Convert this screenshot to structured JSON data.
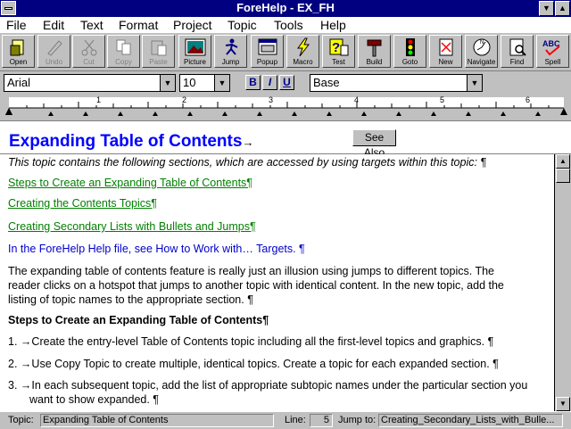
{
  "window": {
    "title": "ForeHelp - EX_FH",
    "minimize": "▼",
    "maximize": "▲"
  },
  "menu": [
    "File",
    "Edit",
    "Text",
    "Format",
    "Project",
    "Topic",
    "Tools",
    "Help"
  ],
  "toolbar": [
    {
      "label": "Open",
      "icon": "open-icon",
      "enabled": true
    },
    {
      "label": "Undo",
      "icon": "undo-icon",
      "enabled": false
    },
    {
      "label": "Cut",
      "icon": "cut-icon",
      "enabled": false
    },
    {
      "label": "Copy",
      "icon": "copy-icon",
      "enabled": false
    },
    {
      "label": "Paste",
      "icon": "paste-icon",
      "enabled": false
    },
    {
      "label": "Picture",
      "icon": "picture-icon",
      "enabled": true
    },
    {
      "label": "Jump",
      "icon": "jump-icon",
      "enabled": true
    },
    {
      "label": "Popup",
      "icon": "popup-icon",
      "enabled": true
    },
    {
      "label": "Macro",
      "icon": "macro-icon",
      "enabled": true
    },
    {
      "label": "Test",
      "icon": "test-icon",
      "enabled": true
    },
    {
      "label": "Build",
      "icon": "build-icon",
      "enabled": true
    },
    {
      "label": "Goto",
      "icon": "goto-icon",
      "enabled": true
    },
    {
      "label": "New",
      "icon": "new-icon",
      "enabled": true
    },
    {
      "label": "Navigate",
      "icon": "navigate-icon",
      "enabled": true
    },
    {
      "label": "Find",
      "icon": "find-icon",
      "enabled": true
    },
    {
      "label": "Spell",
      "icon": "spell-icon",
      "enabled": true
    }
  ],
  "format": {
    "font": "Arial",
    "size": "10",
    "bold": "B",
    "italic": "I",
    "underline": "U",
    "style": "Base"
  },
  "ruler": {
    "numbers": [
      "1",
      "2",
      "3",
      "4",
      "5",
      "6"
    ]
  },
  "topic": {
    "title": "Expanding Table of Contents",
    "title_mark": "→",
    "see_also": "See Also"
  },
  "content": {
    "intro": "This topic contains the following sections, which are accessed by using targets within this topic: ¶",
    "link1": "Steps to Create an Expanding Table of Contents¶",
    "link2": "Creating the Contents Topics¶",
    "link3": "Creating Secondary Lists with Bullets and Jumps¶",
    "ref": "In the ForeHelp Help file, see How to Work with… Targets. ¶",
    "para1": "The expanding table of contents feature is really just an illusion using jumps to different topics. The",
    "para2": "reader clicks on a hotspot that jumps to another topic with identical content. In the new topic, add the",
    "para3": "listing of topic names to the appropriate section. ¶",
    "heading": "Steps to Create an Expanding Table of Contents¶",
    "step1_num": "1.",
    "step1": "Create the entry-level Table of Contents topic including all the first-level topics and graphics. ¶",
    "step2_num": "2.",
    "step2": "Use Copy Topic to create multiple, identical topics. Create a topic for each expanded section. ¶",
    "step3_num": "3.",
    "step3a": "In each subsequent topic, add the list of appropriate subtopic names under the particular section you",
    "step3b": "want to show expanded. ¶"
  },
  "status": {
    "topic_label": "Topic:",
    "topic_value": "Expanding Table of Contents",
    "line_label": "Line:",
    "line_value": "5",
    "jump_label": "Jump to:",
    "jump_value": "Creating_Secondary_Lists_with_Bulle..."
  }
}
